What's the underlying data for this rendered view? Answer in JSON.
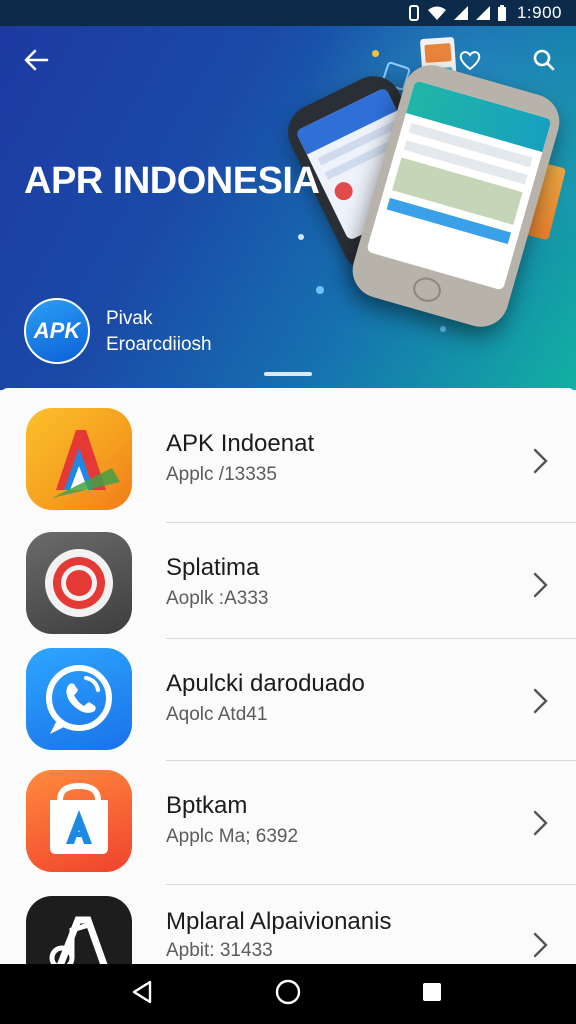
{
  "status_bar": {
    "time": "1:900"
  },
  "header": {
    "title": "APR INDONESIA",
    "avatar_text": "APK",
    "subtitle_line1": "Pivak",
    "subtitle_line2": "Eroarcdiiosh",
    "icons": [
      "back-arrow-icon",
      "heart-icon",
      "search-icon"
    ]
  },
  "apps": [
    {
      "name": "APK Indoenat",
      "subtitle": "Applc /13335",
      "icon": "apk-a-icon"
    },
    {
      "name": "Splatima",
      "subtitle": "Aoplk :A333",
      "icon": "record-icon"
    },
    {
      "name": "Apulcki daroduado",
      "subtitle": "Aqolc Atd41",
      "icon": "phone-chat-icon"
    },
    {
      "name": "Bptkam",
      "subtitle": "Applc Ma; 6392",
      "icon": "store-a-icon"
    },
    {
      "name": "Mplaral Alpaivionanis",
      "subtitle": "Apbit: 31433",
      "icon": "music-a-icon"
    }
  ],
  "nav": {
    "icons": [
      "back-triangle-icon",
      "home-circle-icon",
      "recents-square-icon"
    ]
  },
  "colors": {
    "accent": "#1a5bd0",
    "header_start": "#1d3aa2",
    "header_end": "#12b0a2"
  }
}
